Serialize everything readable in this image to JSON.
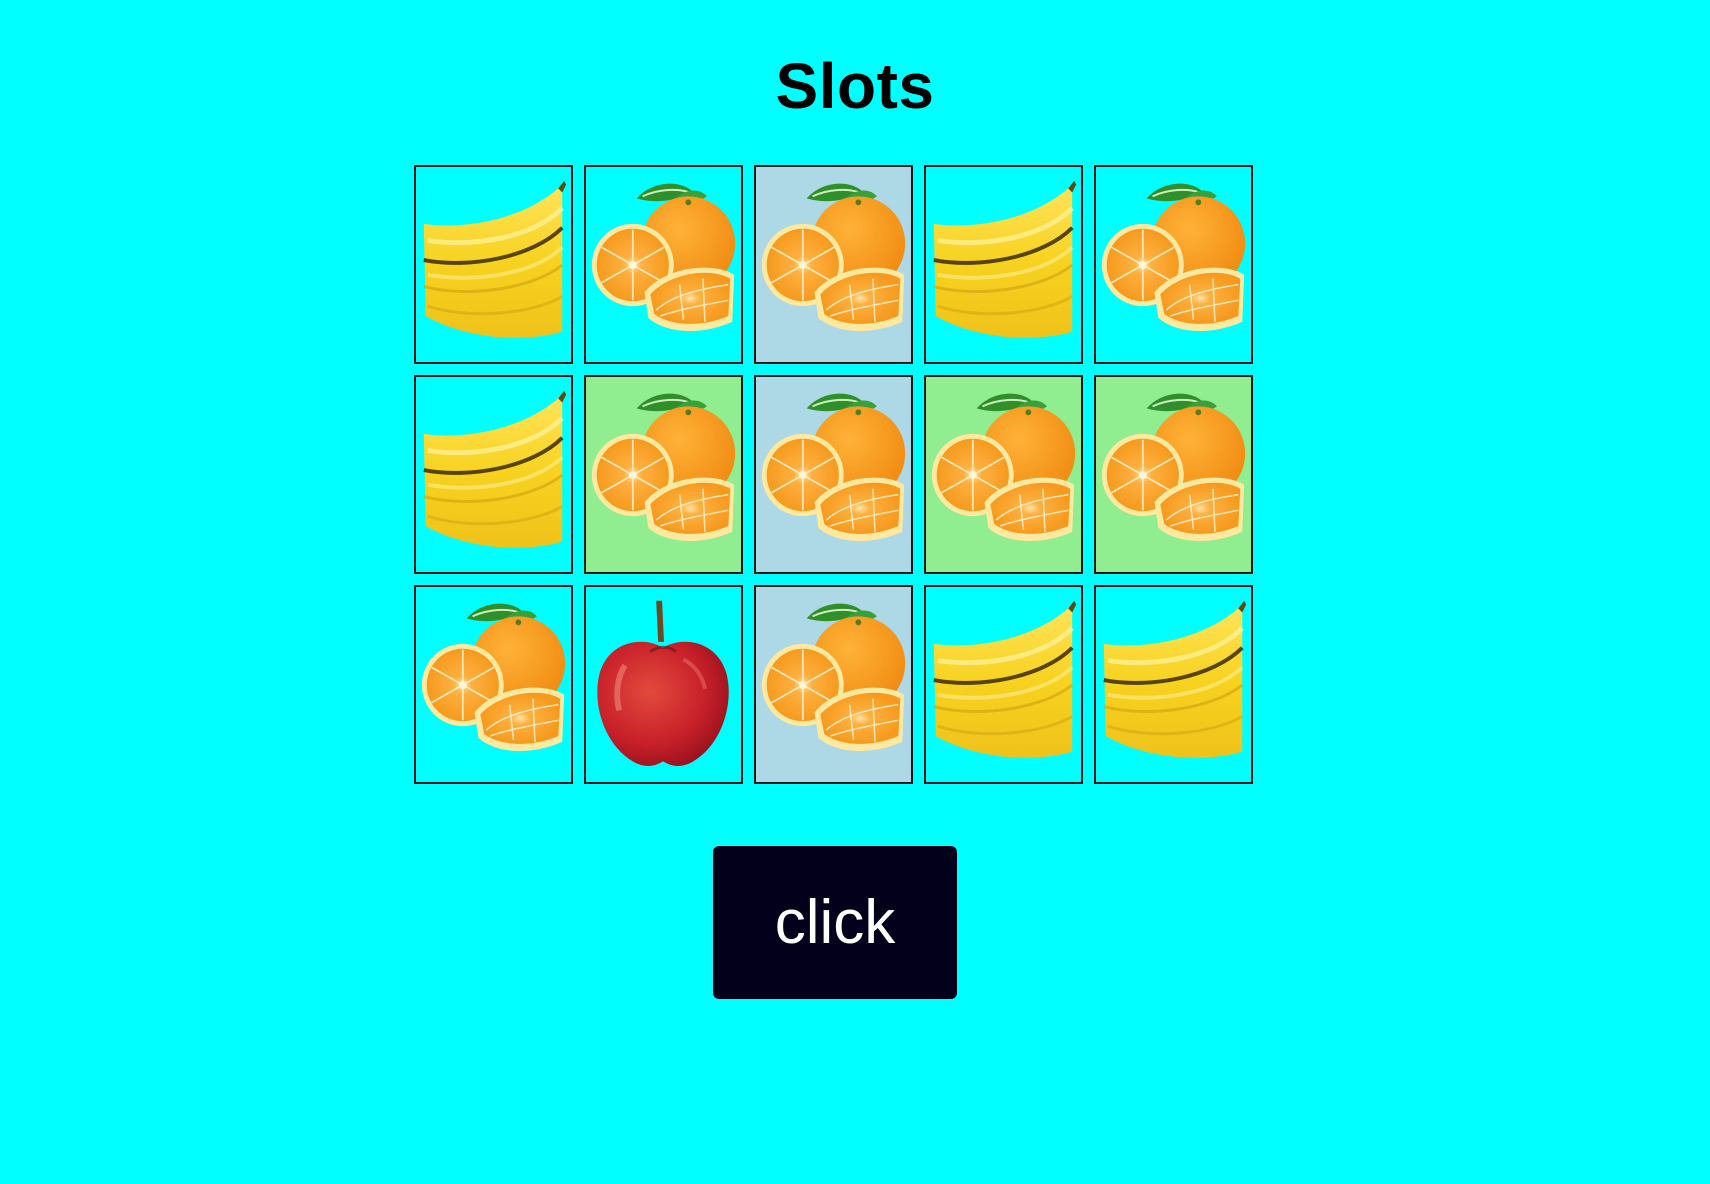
{
  "page": {
    "title": "Slots",
    "background": "#00ffff"
  },
  "reels": {
    "rows": [
      [
        {
          "symbol": "banana",
          "highlight": "none"
        },
        {
          "symbol": "orange",
          "highlight": "none"
        },
        {
          "symbol": "orange",
          "highlight": "blue"
        },
        {
          "symbol": "banana",
          "highlight": "none"
        },
        {
          "symbol": "orange",
          "highlight": "none"
        }
      ],
      [
        {
          "symbol": "banana",
          "highlight": "none"
        },
        {
          "symbol": "orange",
          "highlight": "green"
        },
        {
          "symbol": "orange",
          "highlight": "blue"
        },
        {
          "symbol": "orange",
          "highlight": "green"
        },
        {
          "symbol": "orange",
          "highlight": "green"
        }
      ],
      [
        {
          "symbol": "orange",
          "highlight": "none"
        },
        {
          "symbol": "apple",
          "highlight": "none"
        },
        {
          "symbol": "orange",
          "highlight": "blue"
        },
        {
          "symbol": "banana",
          "highlight": "none"
        },
        {
          "symbol": "banana",
          "highlight": "none"
        }
      ]
    ],
    "highlight_colors": {
      "green": "#90ee90",
      "blue": "#add8e6"
    }
  },
  "controls": {
    "spin_label": "click",
    "spin_color": "#03001c"
  }
}
